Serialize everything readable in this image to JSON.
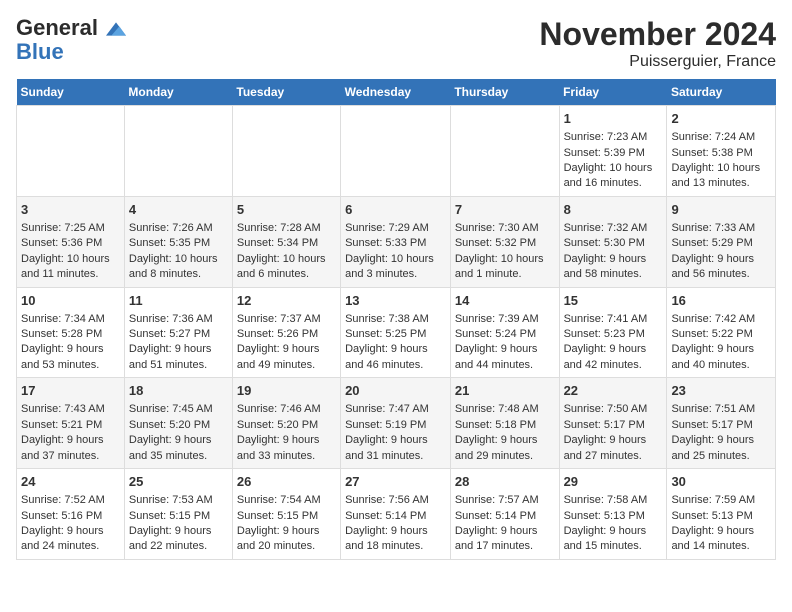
{
  "logo": {
    "line1": "General",
    "line2": "Blue"
  },
  "title": "November 2024",
  "subtitle": "Puisserguier, France",
  "weekdays": [
    "Sunday",
    "Monday",
    "Tuesday",
    "Wednesday",
    "Thursday",
    "Friday",
    "Saturday"
  ],
  "weeks": [
    [
      {
        "day": "",
        "info": ""
      },
      {
        "day": "",
        "info": ""
      },
      {
        "day": "",
        "info": ""
      },
      {
        "day": "",
        "info": ""
      },
      {
        "day": "",
        "info": ""
      },
      {
        "day": "1",
        "info": "Sunrise: 7:23 AM\nSunset: 5:39 PM\nDaylight: 10 hours and 16 minutes."
      },
      {
        "day": "2",
        "info": "Sunrise: 7:24 AM\nSunset: 5:38 PM\nDaylight: 10 hours and 13 minutes."
      }
    ],
    [
      {
        "day": "3",
        "info": "Sunrise: 7:25 AM\nSunset: 5:36 PM\nDaylight: 10 hours and 11 minutes."
      },
      {
        "day": "4",
        "info": "Sunrise: 7:26 AM\nSunset: 5:35 PM\nDaylight: 10 hours and 8 minutes."
      },
      {
        "day": "5",
        "info": "Sunrise: 7:28 AM\nSunset: 5:34 PM\nDaylight: 10 hours and 6 minutes."
      },
      {
        "day": "6",
        "info": "Sunrise: 7:29 AM\nSunset: 5:33 PM\nDaylight: 10 hours and 3 minutes."
      },
      {
        "day": "7",
        "info": "Sunrise: 7:30 AM\nSunset: 5:32 PM\nDaylight: 10 hours and 1 minute."
      },
      {
        "day": "8",
        "info": "Sunrise: 7:32 AM\nSunset: 5:30 PM\nDaylight: 9 hours and 58 minutes."
      },
      {
        "day": "9",
        "info": "Sunrise: 7:33 AM\nSunset: 5:29 PM\nDaylight: 9 hours and 56 minutes."
      }
    ],
    [
      {
        "day": "10",
        "info": "Sunrise: 7:34 AM\nSunset: 5:28 PM\nDaylight: 9 hours and 53 minutes."
      },
      {
        "day": "11",
        "info": "Sunrise: 7:36 AM\nSunset: 5:27 PM\nDaylight: 9 hours and 51 minutes."
      },
      {
        "day": "12",
        "info": "Sunrise: 7:37 AM\nSunset: 5:26 PM\nDaylight: 9 hours and 49 minutes."
      },
      {
        "day": "13",
        "info": "Sunrise: 7:38 AM\nSunset: 5:25 PM\nDaylight: 9 hours and 46 minutes."
      },
      {
        "day": "14",
        "info": "Sunrise: 7:39 AM\nSunset: 5:24 PM\nDaylight: 9 hours and 44 minutes."
      },
      {
        "day": "15",
        "info": "Sunrise: 7:41 AM\nSunset: 5:23 PM\nDaylight: 9 hours and 42 minutes."
      },
      {
        "day": "16",
        "info": "Sunrise: 7:42 AM\nSunset: 5:22 PM\nDaylight: 9 hours and 40 minutes."
      }
    ],
    [
      {
        "day": "17",
        "info": "Sunrise: 7:43 AM\nSunset: 5:21 PM\nDaylight: 9 hours and 37 minutes."
      },
      {
        "day": "18",
        "info": "Sunrise: 7:45 AM\nSunset: 5:20 PM\nDaylight: 9 hours and 35 minutes."
      },
      {
        "day": "19",
        "info": "Sunrise: 7:46 AM\nSunset: 5:20 PM\nDaylight: 9 hours and 33 minutes."
      },
      {
        "day": "20",
        "info": "Sunrise: 7:47 AM\nSunset: 5:19 PM\nDaylight: 9 hours and 31 minutes."
      },
      {
        "day": "21",
        "info": "Sunrise: 7:48 AM\nSunset: 5:18 PM\nDaylight: 9 hours and 29 minutes."
      },
      {
        "day": "22",
        "info": "Sunrise: 7:50 AM\nSunset: 5:17 PM\nDaylight: 9 hours and 27 minutes."
      },
      {
        "day": "23",
        "info": "Sunrise: 7:51 AM\nSunset: 5:17 PM\nDaylight: 9 hours and 25 minutes."
      }
    ],
    [
      {
        "day": "24",
        "info": "Sunrise: 7:52 AM\nSunset: 5:16 PM\nDaylight: 9 hours and 24 minutes."
      },
      {
        "day": "25",
        "info": "Sunrise: 7:53 AM\nSunset: 5:15 PM\nDaylight: 9 hours and 22 minutes."
      },
      {
        "day": "26",
        "info": "Sunrise: 7:54 AM\nSunset: 5:15 PM\nDaylight: 9 hours and 20 minutes."
      },
      {
        "day": "27",
        "info": "Sunrise: 7:56 AM\nSunset: 5:14 PM\nDaylight: 9 hours and 18 minutes."
      },
      {
        "day": "28",
        "info": "Sunrise: 7:57 AM\nSunset: 5:14 PM\nDaylight: 9 hours and 17 minutes."
      },
      {
        "day": "29",
        "info": "Sunrise: 7:58 AM\nSunset: 5:13 PM\nDaylight: 9 hours and 15 minutes."
      },
      {
        "day": "30",
        "info": "Sunrise: 7:59 AM\nSunset: 5:13 PM\nDaylight: 9 hours and 14 minutes."
      }
    ]
  ]
}
